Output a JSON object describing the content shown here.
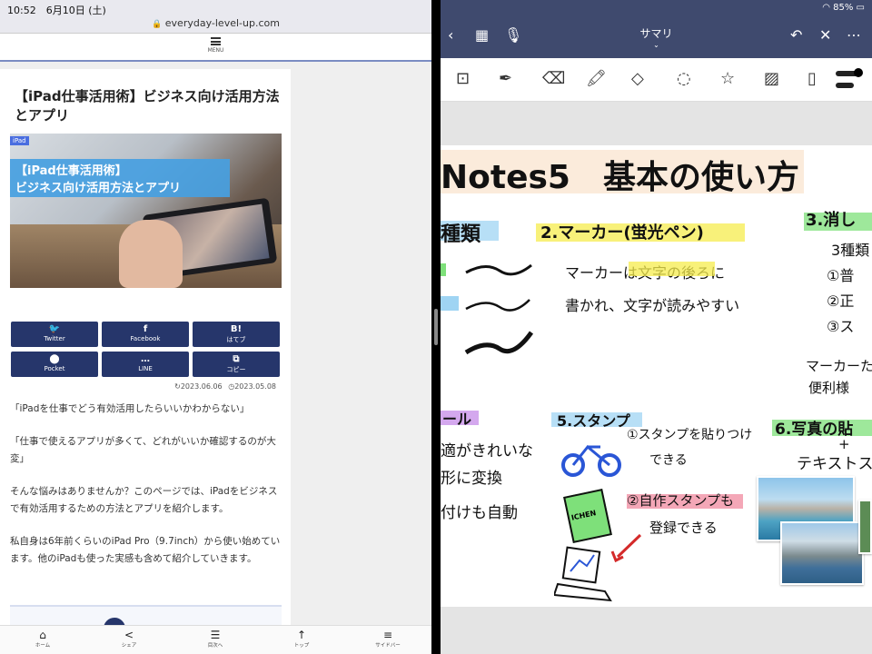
{
  "status": {
    "time_date": "10:52　6月10日 (土)",
    "url": "everyday-level-up.com",
    "battery": "85%"
  },
  "blog": {
    "menu_label": "MENU",
    "title": "【iPad仕事活用術】ビジネス向け活用方法とアプリ",
    "hero": {
      "tag": "iPad",
      "line1": "【iPad仕事活用術】",
      "line2": "ビジネス向け活用方法とアプリ"
    },
    "share": [
      {
        "icon": "🐦",
        "label": "Twitter"
      },
      {
        "icon": "f",
        "label": "Facebook"
      },
      {
        "icon": "B!",
        "label": "はてブ"
      },
      {
        "icon": "⬤",
        "label": "Pocket"
      },
      {
        "icon": "…",
        "label": "LINE"
      },
      {
        "icon": "⧉",
        "label": "コピー"
      }
    ],
    "updated": "2023.06.06",
    "published": "2023.05.08",
    "paragraphs": [
      "「iPadを仕事でどう有効活用したらいいかわからない」",
      "「仕事で使えるアプリが多くて、どれがいいか確認するのが大変」",
      "そんな悩みはありませんか？このページでは、iPadをビジネスで有効活用するための方法とアプリを紹介します。",
      "私自身は6年前くらいのiPad Pro（9.7inch）から使い始めています。他のiPadも使った実感も含めて紹介していきます。"
    ],
    "bottom_nav": [
      {
        "icon": "⌂",
        "label": "ホーム"
      },
      {
        "icon": "<",
        "label": "シェア"
      },
      {
        "icon": "☰",
        "label": "目次へ"
      },
      {
        "icon": "↑",
        "label": "トップ"
      },
      {
        "icon": "≡",
        "label": "サイドバー"
      }
    ]
  },
  "notes": {
    "doc_title": "サマリ",
    "heading": "Notes5　基本の使い方",
    "sec1": "種類",
    "sec2": "2.マーカー(蛍光ペン)",
    "sec2_body1": "マーカーは文字の後ろに",
    "sec2_body2": "書かれ、文字が読みやすい",
    "sec3": "3.消し",
    "sec3_body": [
      "3種類",
      "①普",
      "②正",
      "③ス",
      "マーカーた",
      "便利様"
    ],
    "sec4": "ール",
    "sec4_body": [
      "適がきれいな",
      "形に変換",
      "付けも自動"
    ],
    "sec5": "5.スタンプ",
    "sec5_b1": [
      "①スタンプを貼りつけ",
      "できる"
    ],
    "sec5_b2": [
      "②自作スタンプも",
      "登録できる"
    ],
    "stamp_text": "ICHEN",
    "sec6": "6.写真の貼",
    "sec6_b": [
      "+",
      "テキストス"
    ],
    "colors": {
      "navy": "#26366b",
      "topbar": "#3f4a6e",
      "yellow": "#f6ec4d",
      "blue": "#9fd4f3",
      "green": "#7ee07a",
      "pink": "#f06aa8",
      "purple": "#c68be8"
    }
  }
}
